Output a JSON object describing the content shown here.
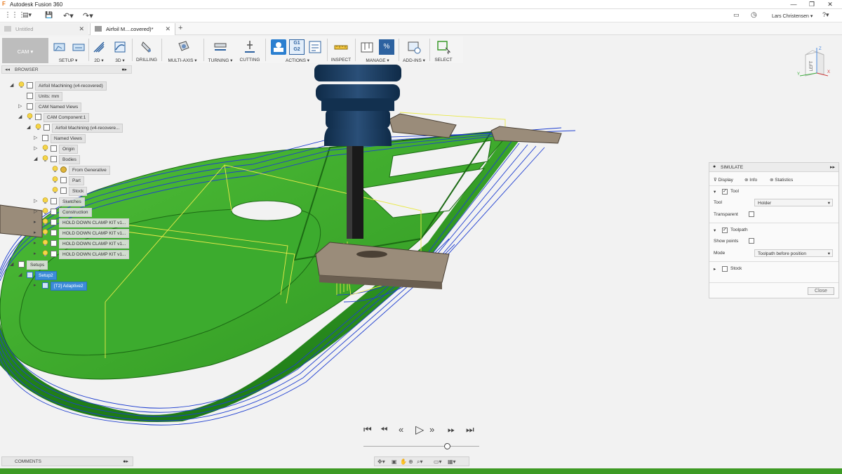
{
  "window": {
    "title": "Autodesk Fusion 360",
    "minimize": "—",
    "restore": "❐",
    "close": "✕"
  },
  "quickbar": {
    "grid": "⋮⋮⋮",
    "file": "▤▾",
    "save": "💾",
    "undo": "↶▾",
    "redo": "↷▾",
    "user": "Lars Christensen ▾",
    "help": "?▾"
  },
  "tabs": [
    {
      "label": "Untitled"
    },
    {
      "label": "Airfoil M....covered)*"
    }
  ],
  "ribbon": {
    "workspace": "CAM ▾",
    "groups": [
      {
        "label": "SETUP ▾"
      },
      {
        "label": "2D ▾"
      },
      {
        "label": "3D ▾"
      },
      {
        "label": "DRILLING"
      },
      {
        "label": "MULTI-AXIS ▾"
      },
      {
        "label": "TURNING ▾"
      },
      {
        "label": "CUTTING"
      },
      {
        "label": "ACTIONS ▾"
      },
      {
        "label": "INSPECT"
      },
      {
        "label": "MANAGE ▾"
      },
      {
        "label": "ADD-INS ▾"
      },
      {
        "label": "SELECT"
      }
    ],
    "actions_g1": "G1",
    "actions_g2": "G2",
    "manage_pct": "%"
  },
  "browser": {
    "title": "BROWSER",
    "nodes": [
      {
        "label": "Airfoil Machining (v4-recovered)"
      },
      {
        "label": "Units: mm"
      },
      {
        "label": "CAM Named Views"
      },
      {
        "label": "CAM Component:1"
      },
      {
        "label": "Airfoil Machining (v4-recovere..."
      },
      {
        "label": "Named Views"
      },
      {
        "label": "Origin"
      },
      {
        "label": "Bodies"
      },
      {
        "label": "From Generative"
      },
      {
        "label": "Part"
      },
      {
        "label": "Stock"
      },
      {
        "label": "Sketches"
      },
      {
        "label": "Construction"
      },
      {
        "label": "HOLD DOWN CLAMP KIT v1..."
      },
      {
        "label": "HOLD DOWN CLAMP KIT v1..."
      },
      {
        "label": "HOLD DOWN CLAMP KIT v1..."
      },
      {
        "label": "HOLD DOWN CLAMP KIT v1..."
      },
      {
        "label": "Setups"
      },
      {
        "label": "Setup2"
      },
      {
        "label": "[T2] Adaptive2"
      }
    ]
  },
  "comments": {
    "label": "COMMENTS"
  },
  "simulate": {
    "title": "SIMULATE",
    "tabs": [
      "Display",
      "Info",
      "Statistics"
    ],
    "tool_section": "Tool",
    "tool_label": "Tool",
    "tool_value": "Holder",
    "transparent_label": "Transparent",
    "toolpath_section": "Toolpath",
    "show_points_label": "Show points",
    "mode_label": "Mode",
    "mode_value": "Toolpath before position",
    "stock_section": "Stock",
    "close_label": "Close"
  },
  "viewcube": {
    "face": "LEFT",
    "x_axis": "X",
    "y_axis": "Y",
    "z_axis": "Z"
  },
  "transport": {
    "first": "K",
    "back_loop": "O<",
    "rewind": "«",
    "play": "▷",
    "forward": "»",
    "fwd_loop": ">O",
    "last": "K"
  },
  "colors": {
    "part": "#2e9a22",
    "toolpath_blue": "#1f3fd0",
    "toolpath_yellow": "#e9e94a",
    "tool_holder": "#1e3c5e",
    "selection": "#3c8cd8"
  }
}
